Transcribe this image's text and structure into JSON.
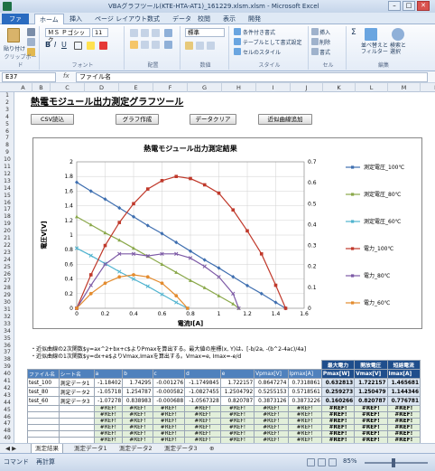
{
  "window": {
    "title": "VBAグラフツール(KTE-HTA-AT1)_161229.xlsm.xlsm - Microsoft Excel",
    "min": "–",
    "max": "□",
    "close": "✕"
  },
  "ribbon_tabs": [
    "ファイル",
    "ホーム",
    "挿入",
    "ページ レイアウト",
    "数式",
    "データ",
    "校閲",
    "表示",
    "開発"
  ],
  "ribbon": {
    "paste": "貼り付け",
    "clipboard": "クリップボード",
    "font_name": "ＭＳ Ｐゴシック",
    "font_size": "11",
    "font_group": "フォント",
    "align_group": "配置",
    "number_format": "標準",
    "number_group": "数値",
    "cond_format": "条件付き書式",
    "table_format": "テーブルとして書式設定",
    "cell_style": "セルのスタイル",
    "style_group": "スタイル",
    "insert": "挿入",
    "delete": "削除",
    "format": "書式",
    "cells_group": "セル",
    "sort_filter": "並べ替えと\nフィルター",
    "find_select": "検索と\n選択",
    "edit_group": "編集",
    "sigma": "Σ"
  },
  "formula_bar": {
    "name_box": "E37",
    "fx": "fx",
    "value": "ファイル名"
  },
  "columns": [
    "A",
    "B",
    "C",
    "D",
    "E",
    "F",
    "G",
    "H",
    "I",
    "J",
    "K",
    "L",
    "M",
    "N"
  ],
  "rows": [
    "1",
    "2",
    "3",
    "4",
    "5",
    "6",
    "7",
    "8",
    "9",
    "10",
    "11",
    "12",
    "13",
    "14",
    "15",
    "16",
    "17",
    "18",
    "19",
    "20",
    "21",
    "22",
    "23",
    "24",
    "25",
    "26",
    "27",
    "28",
    "29",
    "30",
    "31",
    "32",
    "33",
    "34",
    "35",
    "36",
    "37",
    "38",
    "39",
    "40",
    "41",
    "42",
    "43",
    "44",
    "45",
    "46",
    "47",
    "48",
    "49"
  ],
  "sheet": {
    "heading": "熱電モジュール出力測定グラフツール",
    "buttons": [
      "CSV読込",
      "グラフ作成",
      "データクリア",
      "近似曲線追加"
    ],
    "notes": [
      "・近似曲線の2次関数$y=ax^2+bx+c$よりPmaxを算出する。最大値の座標(x, Y)は、[-b/2a, -(b^2-4ac)/4a]",
      "・近似曲線の1次関数$y=dx+e$よりVmax,Imaxを算出する。Vmax=e, Imax=-e/d"
    ]
  },
  "table": {
    "top_headers": [
      "最大電力",
      "開放電圧",
      "短絡電流"
    ],
    "headers": [
      "ファイル名",
      "シート名",
      "a",
      "b",
      "c",
      "d",
      "e",
      "Vpmax[V]",
      "Ipmax[A]",
      "Pmax[W]",
      "Vmax[V]",
      "Imax[A]"
    ],
    "rows": [
      [
        "test_100",
        "測定データ1",
        "-1.18402",
        "1.74295",
        "-0.001276",
        "-1.1749845",
        "1.722157",
        "0.8647274",
        "0.7318861",
        "0.632813",
        "1.722157",
        "1.465681"
      ],
      [
        "test_80",
        "測定データ2",
        "-1.05718",
        "1.254787",
        "-0.000582",
        "-1.0827455",
        "1.2504792",
        "0.5255153",
        "0.5718561",
        "0.259273",
        "1.250479",
        "1.144346"
      ],
      [
        "test_60",
        "測定データ3",
        "-1.07278",
        "0.838983",
        "-0.000688",
        "-1.0567328",
        "0.820787",
        "0.3873126",
        "0.3873226",
        "0.160266",
        "0.820787",
        "0.776781"
      ]
    ],
    "ref_error": "#REF!"
  },
  "chart_data": {
    "type": "line",
    "title": "熱電モジュール出力測定結果",
    "xlabel": "電流I[A]",
    "ylabel": "電圧V[V]",
    "y2label": "電力[W]",
    "xlim": [
      0,
      1.6
    ],
    "ylim": [
      0,
      2
    ],
    "y2lim": [
      0,
      0.7
    ],
    "xticks": [
      "0",
      "0.2",
      "0.4",
      "0.6",
      "0.8",
      "1",
      "1.2",
      "1.4",
      "1.6"
    ],
    "yticks": [
      "0",
      "0.2",
      "0.4",
      "0.6",
      "0.8",
      "1",
      "1.2",
      "1.4",
      "1.6",
      "1.8",
      "2"
    ],
    "y2ticks": [
      "0",
      "0.1",
      "0.2",
      "0.3",
      "0.4",
      "0.5",
      "0.6",
      "0.7"
    ],
    "grid": true,
    "legend_placement": "right",
    "series": [
      {
        "name": "測定電圧_100℃",
        "axis": "y",
        "color": "#3f6fb0",
        "marker": "diamond",
        "x": [
          0,
          0.1,
          0.2,
          0.3,
          0.4,
          0.5,
          0.6,
          0.7,
          0.8,
          0.9,
          1.0,
          1.1,
          1.2,
          1.3,
          1.4,
          1.47
        ],
        "y": [
          1.72,
          1.6,
          1.49,
          1.37,
          1.25,
          1.13,
          1.02,
          0.9,
          0.78,
          0.66,
          0.55,
          0.43,
          0.31,
          0.2,
          0.08,
          0.0
        ]
      },
      {
        "name": "測定電圧_80℃",
        "axis": "y",
        "color": "#8aa84a",
        "marker": "triangle",
        "x": [
          0,
          0.1,
          0.2,
          0.3,
          0.4,
          0.5,
          0.6,
          0.7,
          0.8,
          0.9,
          1.0,
          1.1,
          1.14
        ],
        "y": [
          1.25,
          1.14,
          1.03,
          0.93,
          0.82,
          0.71,
          0.6,
          0.49,
          0.38,
          0.28,
          0.17,
          0.06,
          0.0
        ]
      },
      {
        "name": "測定電圧_60℃",
        "axis": "y",
        "color": "#4fb3cf",
        "marker": "x",
        "x": [
          0,
          0.1,
          0.2,
          0.3,
          0.4,
          0.5,
          0.6,
          0.7,
          0.78
        ],
        "y": [
          0.82,
          0.72,
          0.61,
          0.5,
          0.4,
          0.3,
          0.19,
          0.08,
          0.0
        ]
      },
      {
        "name": "電力_100℃",
        "axis": "y2",
        "color": "#c0392b",
        "marker": "square",
        "x": [
          0,
          0.1,
          0.2,
          0.3,
          0.4,
          0.5,
          0.6,
          0.7,
          0.8,
          0.9,
          1.0,
          1.1,
          1.2,
          1.3,
          1.4,
          1.47
        ],
        "y": [
          0,
          0.16,
          0.3,
          0.41,
          0.5,
          0.57,
          0.61,
          0.63,
          0.62,
          0.59,
          0.55,
          0.47,
          0.37,
          0.26,
          0.11,
          0.0
        ]
      },
      {
        "name": "電力_80℃",
        "axis": "y2",
        "color": "#7d5aa6",
        "marker": "x",
        "x": [
          0,
          0.1,
          0.2,
          0.3,
          0.4,
          0.5,
          0.6,
          0.7,
          0.8,
          0.9,
          1.0,
          1.1,
          1.14
        ],
        "y": [
          0,
          0.11,
          0.21,
          0.26,
          0.26,
          0.25,
          0.26,
          0.26,
          0.24,
          0.2,
          0.15,
          0.07,
          0.0
        ]
      },
      {
        "name": "電力_60℃",
        "axis": "y2",
        "color": "#e38b2e",
        "marker": "circle",
        "x": [
          0,
          0.1,
          0.2,
          0.3,
          0.4,
          0.5,
          0.6,
          0.7,
          0.78
        ],
        "y": [
          0,
          0.07,
          0.12,
          0.15,
          0.16,
          0.15,
          0.12,
          0.06,
          0.0
        ]
      }
    ]
  },
  "sheet_tabs": [
    "測定結果",
    "測定データ1",
    "測定データ2",
    "測定データ3"
  ],
  "status": {
    "mode": "コマンド",
    "mode2": "再計算",
    "zoom": "85%"
  }
}
